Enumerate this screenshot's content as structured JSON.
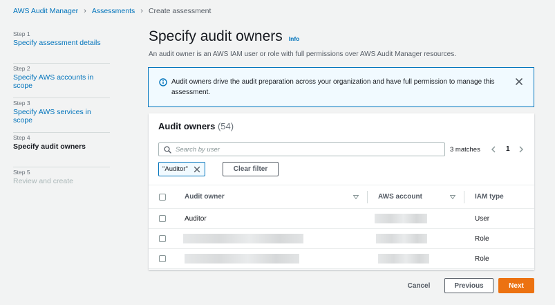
{
  "breadcrumb": {
    "items": [
      "AWS Audit Manager",
      "Assessments",
      "Create assessment"
    ]
  },
  "steps": [
    {
      "number": "Step 1",
      "title": "Specify assessment details",
      "state": "link"
    },
    {
      "number": "Step 2",
      "title": "Specify AWS accounts in scope",
      "state": "link"
    },
    {
      "number": "Step 3",
      "title": "Specify AWS services in scope",
      "state": "link"
    },
    {
      "number": "Step 4",
      "title": "Specify audit owners",
      "state": "active"
    },
    {
      "number": "Step 5",
      "title": "Review and create",
      "state": "disabled"
    }
  ],
  "page": {
    "title": "Specify audit owners",
    "info_link": "Info",
    "description": "An audit owner is an AWS IAM user or role with full permissions over AWS Audit Manager resources."
  },
  "alert": {
    "text": "Audit owners drive the audit preparation across your organization and have full permission to manage this assessment."
  },
  "table": {
    "title": "Audit owners",
    "count": "(54)",
    "search_placeholder": "Search by user",
    "matches": "3 matches",
    "current_page": "1",
    "filter_token": "\"Auditor\"",
    "clear_filter": "Clear filter",
    "columns": [
      "Audit owner",
      "AWS account",
      "IAM type"
    ],
    "rows": [
      {
        "owner": "Auditor",
        "account": "",
        "iam_type": "User"
      },
      {
        "owner": "",
        "account": "",
        "iam_type": "Role"
      },
      {
        "owner": "",
        "account": "",
        "iam_type": "Role"
      }
    ]
  },
  "footer": {
    "cancel": "Cancel",
    "previous": "Previous",
    "next": "Next"
  },
  "colors": {
    "link": "#0073bb",
    "primary_button": "#ec7211",
    "alert_background": "#f1faff",
    "page_background": "#f2f3f3"
  }
}
